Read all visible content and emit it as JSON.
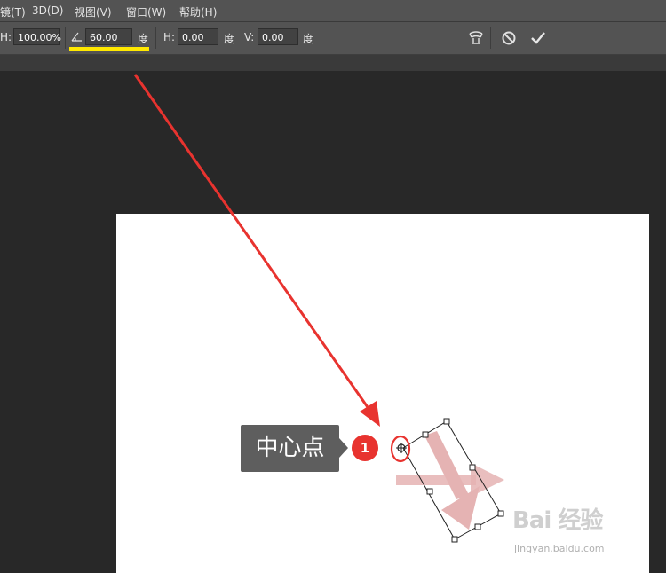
{
  "menubar": {
    "items": [
      "镜(T)",
      "3D(D)",
      "视图(V)",
      "窗口(W)",
      "帮助(H)"
    ]
  },
  "options": {
    "h_scale_label": "H:",
    "h_scale_value": "100.00%",
    "angle_value": "60.00",
    "angle_unit": "度",
    "h_skew_label": "H:",
    "h_skew_value": "0.00",
    "h_skew_unit": "度",
    "v_skew_label": "V:",
    "v_skew_value": "0.00",
    "v_skew_unit": "度"
  },
  "annotation": {
    "callout_label": "中心点",
    "step_number": "1"
  },
  "watermark": {
    "brand": "Bai 经验",
    "url": "jingyan.baidu.com"
  },
  "colors": {
    "annotation_red": "#e8332f",
    "highlight_yellow": "#ffe800",
    "arrow_pink": "#e5b3b3"
  },
  "icons": {
    "angle": "rotate-angle-icon",
    "warp": "warp-mode-icon",
    "cancel": "cancel-transform-icon",
    "commit": "commit-transform-icon"
  }
}
